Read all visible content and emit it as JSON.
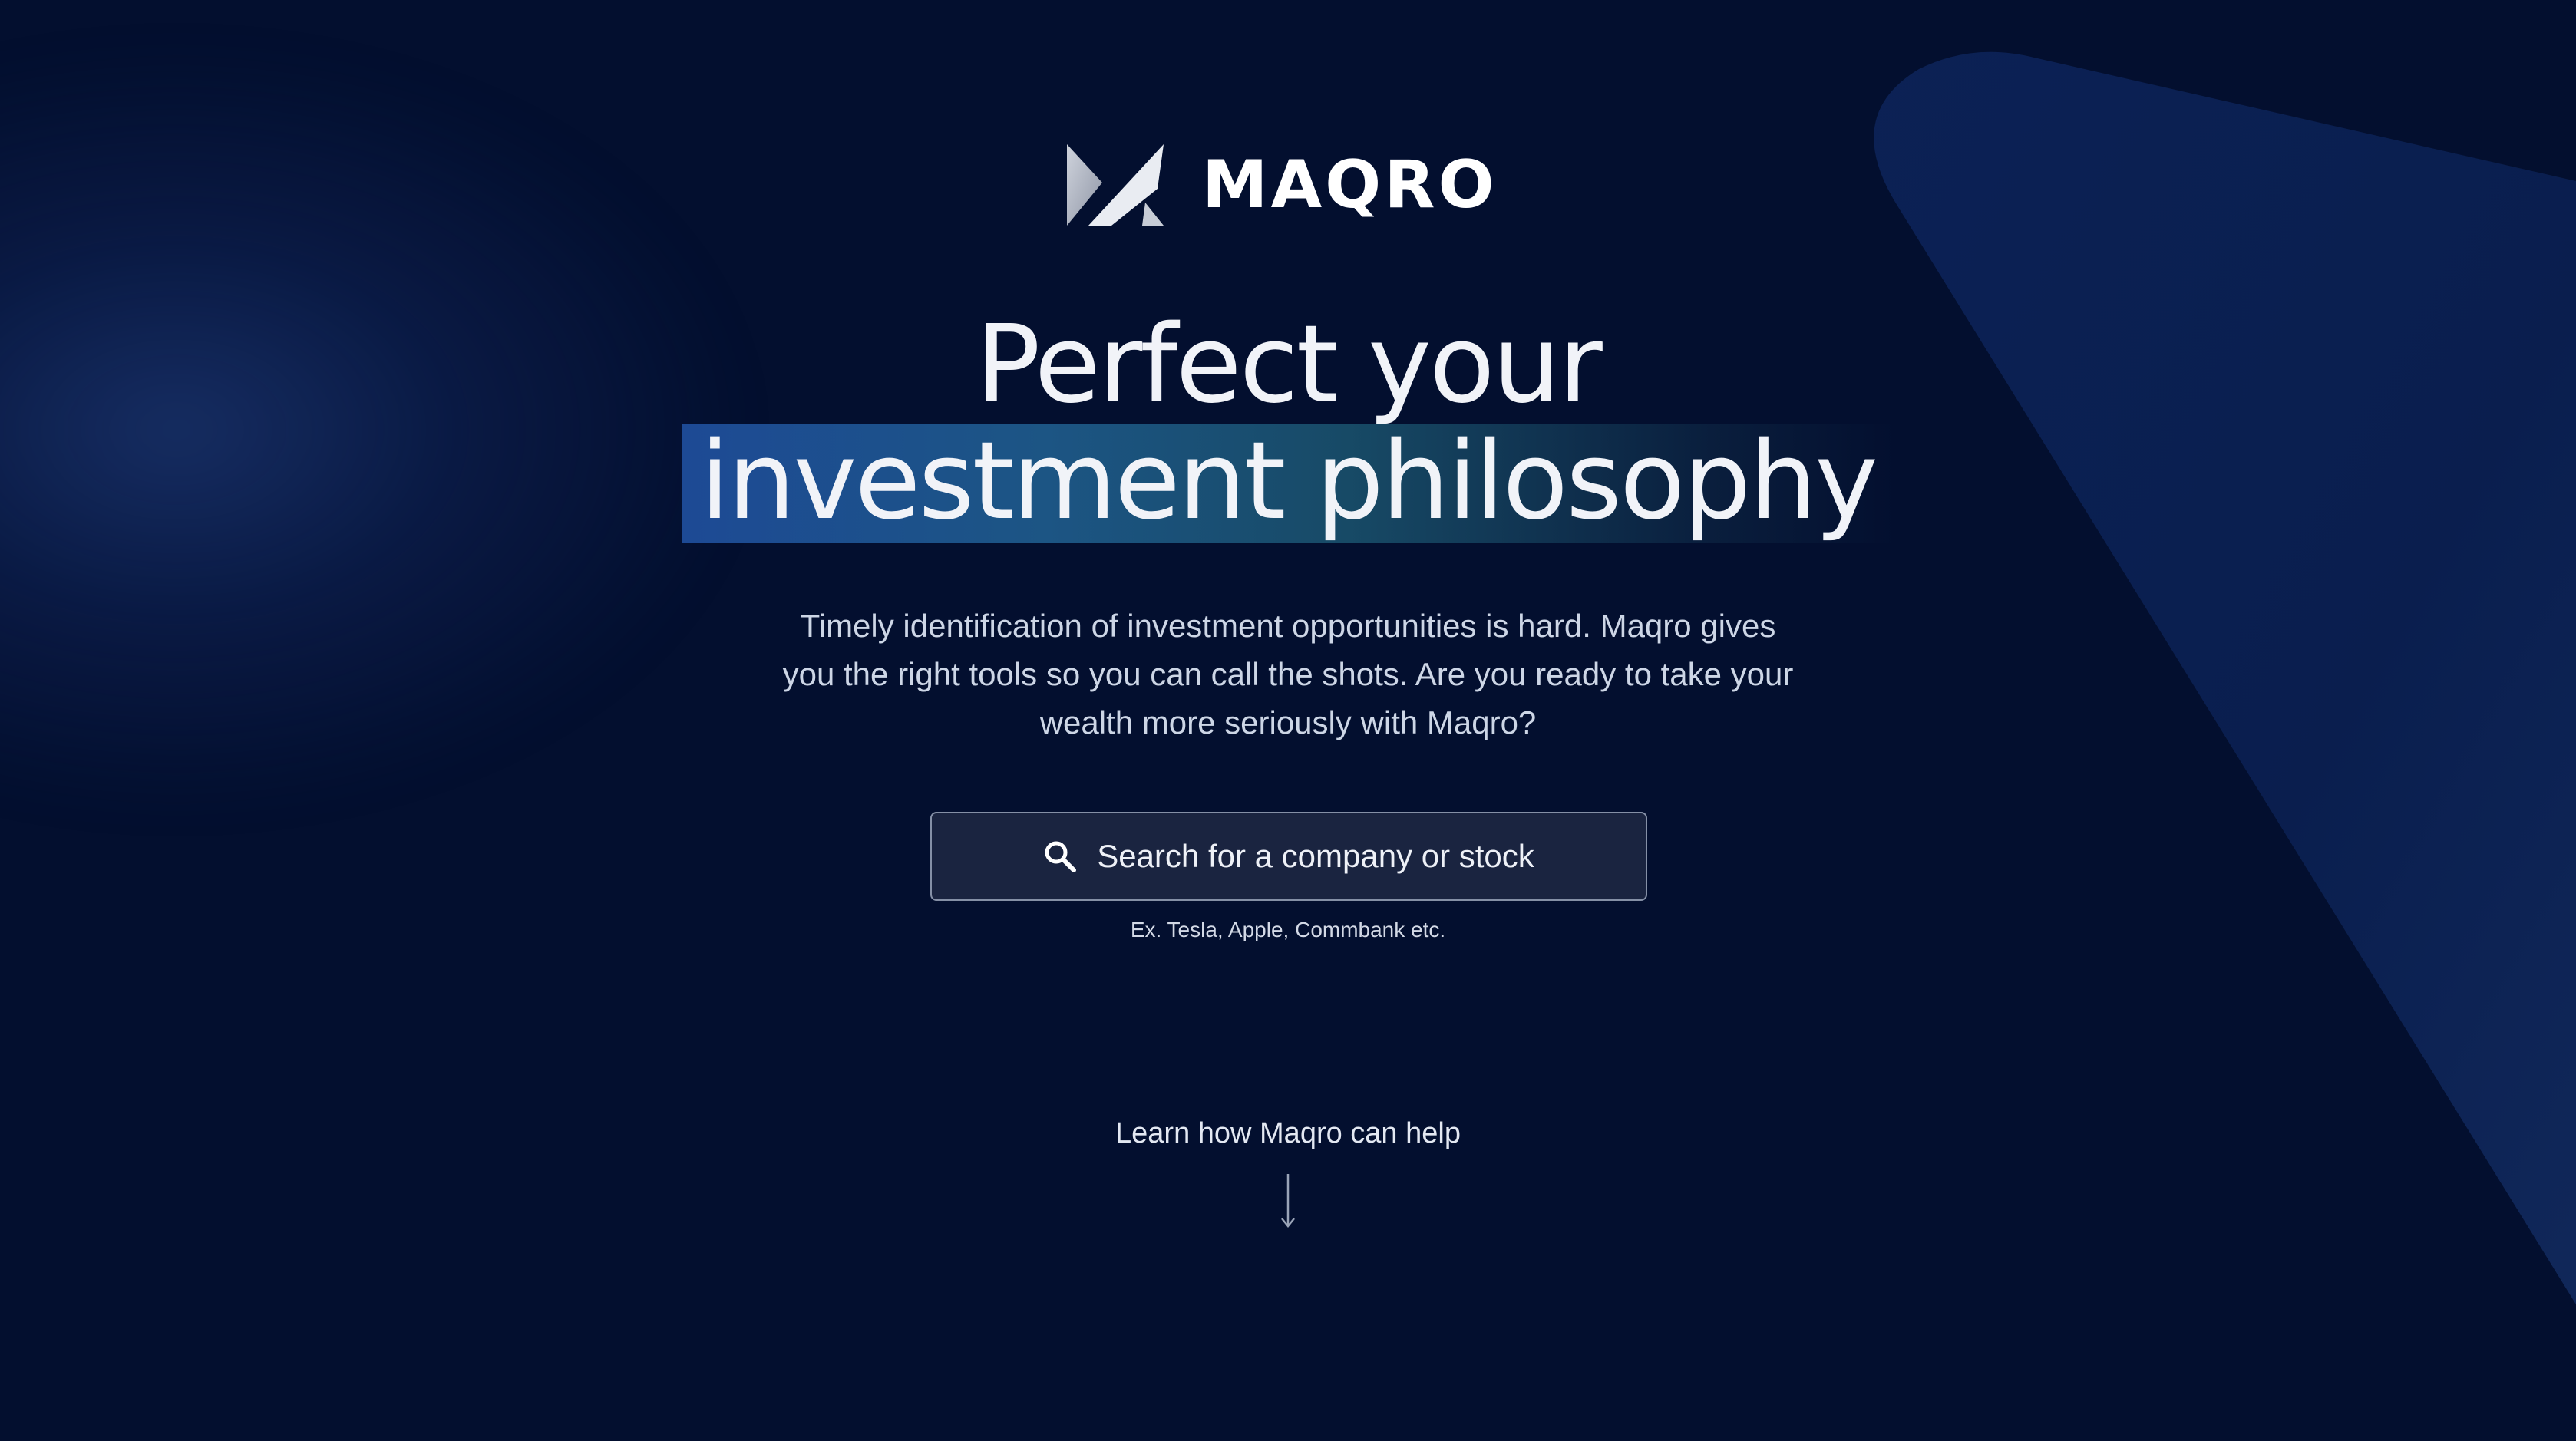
{
  "brand": {
    "name": "MAQRO",
    "logo_icon": "maqro-logo-icon"
  },
  "hero": {
    "headline_line1": "Perfect your",
    "headline_line2": "investment philosophy",
    "subtitle_line1": "Timely identification of investment opportunities is hard. Maqro gives",
    "subtitle_line2": "you the right tools so you can call the shots. Are you ready to take your",
    "subtitle_line3": "wealth more seriously with Maqro?"
  },
  "search": {
    "placeholder": "Search for a company or stock",
    "icon": "search-icon",
    "hint": "Ex. Tesla, Apple, Commbank etc."
  },
  "learn_more": {
    "label": "Learn how Maqro can help",
    "icon": "arrow-down-icon"
  },
  "colors": {
    "background": "#030f2f",
    "highlight_start": "#1d4a95",
    "highlight_end": "#174a66",
    "search_bg": "#1a2440",
    "search_border": "#8590a6"
  }
}
